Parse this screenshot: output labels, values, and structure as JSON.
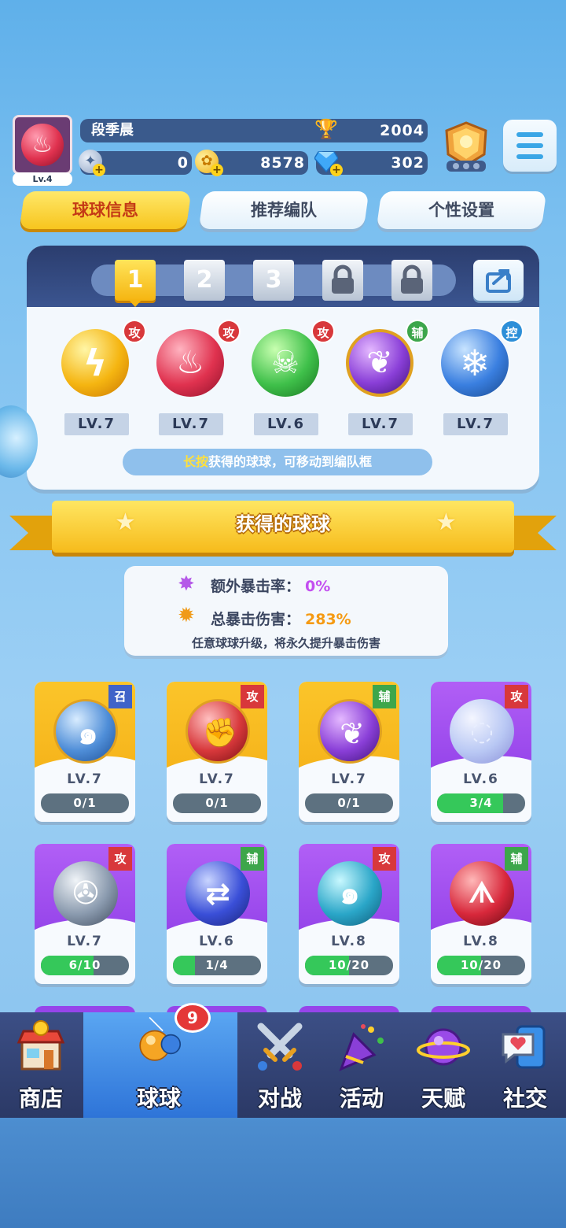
{
  "player": {
    "name": "段季晨",
    "level_label": "Lv.4",
    "trophies": "2004",
    "currency_silver": "0",
    "currency_gold": "8578",
    "currency_gem": "302"
  },
  "tabs": [
    {
      "label": "球球信息",
      "active": true
    },
    {
      "label": "推荐编队",
      "active": false
    },
    {
      "label": "个性设置",
      "active": false
    }
  ],
  "team": {
    "slots": [
      "1",
      "2",
      "3",
      "lock",
      "lock"
    ],
    "active_slot": "1",
    "balls": [
      {
        "tag": "攻",
        "level": "LV.7",
        "color": "#f5b511",
        "icon": "lightning-icon"
      },
      {
        "tag": "攻",
        "level": "LV.7",
        "color": "#e0324f",
        "icon": "flame-icon"
      },
      {
        "tag": "攻",
        "level": "LV.6",
        "color": "#3fc04a",
        "icon": "skull-icon"
      },
      {
        "tag": "辅",
        "level": "LV.7",
        "color": "#8a3fd8",
        "icon": "leaf-icon"
      },
      {
        "tag": "控",
        "level": "LV.7",
        "color": "#3a7fe0",
        "icon": "snowflake-icon"
      }
    ],
    "hint_highlight": "长按",
    "hint_rest": "获得的球球，可移动到编队框"
  },
  "section": {
    "title": "获得的球球"
  },
  "stats": {
    "extra_crit_label": "额外暴击率：",
    "extra_crit_value": "0%",
    "total_crit_label": "总暴击伤害：",
    "total_crit_value": "283%",
    "note": "任意球球升级，将永久提升暴击伤害"
  },
  "cards": [
    {
      "tag": "召",
      "level": "LV.7",
      "progress": "0/1",
      "fill": 0,
      "theme": "gold",
      "color": "#4f8ed8",
      "icon": "vortex-icon"
    },
    {
      "tag": "攻",
      "level": "LV.7",
      "progress": "0/1",
      "fill": 0,
      "theme": "gold",
      "color": "#d8383b",
      "icon": "fist-icon"
    },
    {
      "tag": "辅",
      "level": "LV.7",
      "progress": "0/1",
      "fill": 0,
      "theme": "gold",
      "color": "#8a3fd8",
      "icon": "leaf-icon"
    },
    {
      "tag": "攻",
      "level": "LV.6",
      "progress": "3/4",
      "fill": 0.75,
      "theme": "purple",
      "color": "#b9c8f4",
      "icon": "bubble-icon"
    },
    {
      "tag": "攻",
      "level": "LV.7",
      "progress": "6/10",
      "fill": 0.6,
      "theme": "purple",
      "color": "#8a9aae",
      "icon": "fan-icon"
    },
    {
      "tag": "辅",
      "level": "LV.6",
      "progress": "1/4",
      "fill": 0.25,
      "theme": "purple",
      "color": "#3a4fd8",
      "icon": "swap-arrow-icon"
    },
    {
      "tag": "攻",
      "level": "LV.8",
      "progress": "10/20",
      "fill": 0.5,
      "theme": "purple",
      "color": "#2aa6c8",
      "icon": "whirlpool-icon"
    },
    {
      "tag": "辅",
      "level": "LV.8",
      "progress": "10/20",
      "fill": 0.5,
      "theme": "purple",
      "color": "#d8283b",
      "icon": "fangs-icon"
    }
  ],
  "nav": {
    "badge_count": "9",
    "items": [
      {
        "label": "商店",
        "icon": "shop-icon"
      },
      {
        "label": "球球",
        "icon": "balls-icon",
        "active": true
      },
      {
        "label": "对战",
        "icon": "crossed-swords-icon"
      },
      {
        "label": "活动",
        "icon": "party-popper-icon"
      },
      {
        "label": "天赋",
        "icon": "planet-icon"
      },
      {
        "label": "社交",
        "icon": "chat-heart-icon"
      }
    ]
  }
}
